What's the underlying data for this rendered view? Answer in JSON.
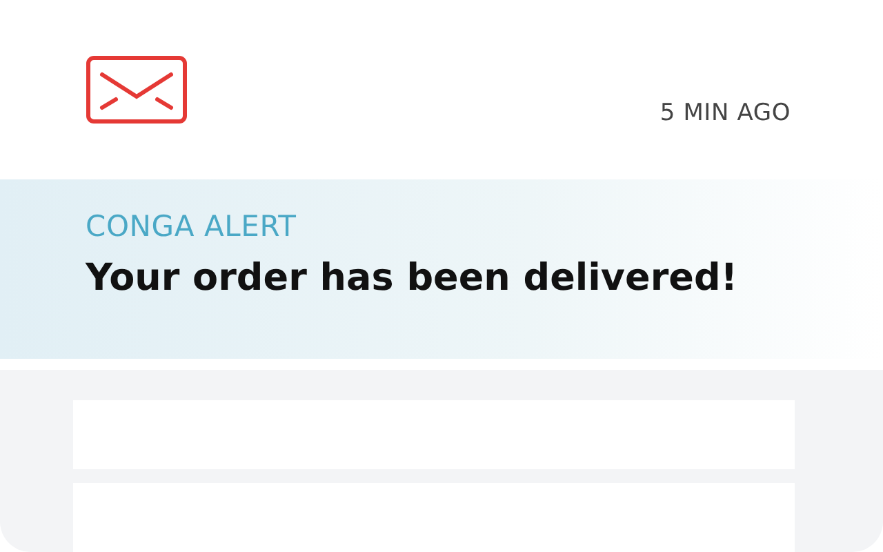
{
  "notification": {
    "time": "5 MIN AGO",
    "source": "CONGA ALERT",
    "message": "Your order has been delivered!"
  },
  "list": {
    "rows": [
      {
        "kind": "blank"
      },
      {
        "kind": "blank"
      }
    ]
  }
}
